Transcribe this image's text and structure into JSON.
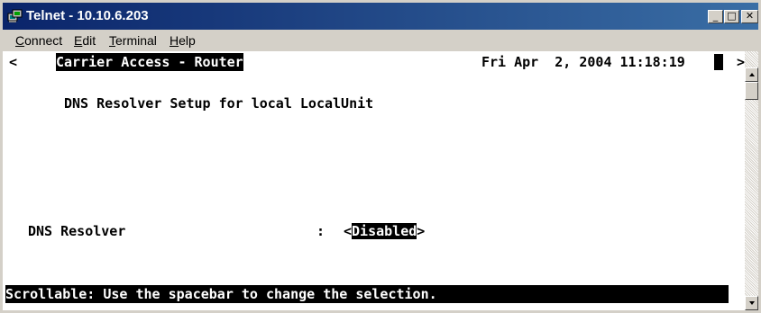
{
  "window": {
    "title": "Telnet - 10.10.6.203",
    "controls": {
      "minimize": "_",
      "maximize": "□",
      "close": "✕"
    }
  },
  "menu": {
    "items": [
      {
        "key": "C",
        "rest": "onnect"
      },
      {
        "key": "E",
        "rest": "dit"
      },
      {
        "key": "T",
        "rest": "erminal"
      },
      {
        "key": "H",
        "rest": "elp"
      }
    ]
  },
  "terminal": {
    "left_arrow": "<",
    "product_title": "Carrier Access - Router",
    "datetime": "Fri Apr  2, 2004 11:18:19",
    "right_arrow": ">",
    "screen_title": "DNS Resolver Setup for local LocalUnit",
    "field_label": "DNS Resolver",
    "field_separator": ":",
    "field_open": "<",
    "field_value": "Disabled",
    "field_close": ">",
    "status_line": "Scrollable: Use the spacebar to change the selection.                        "
  },
  "colors": {
    "titlebar_start": "#0a246a",
    "titlebar_end": "#3a6ea5",
    "terminal_bg": "#ffffff",
    "terminal_fg": "#000000"
  }
}
